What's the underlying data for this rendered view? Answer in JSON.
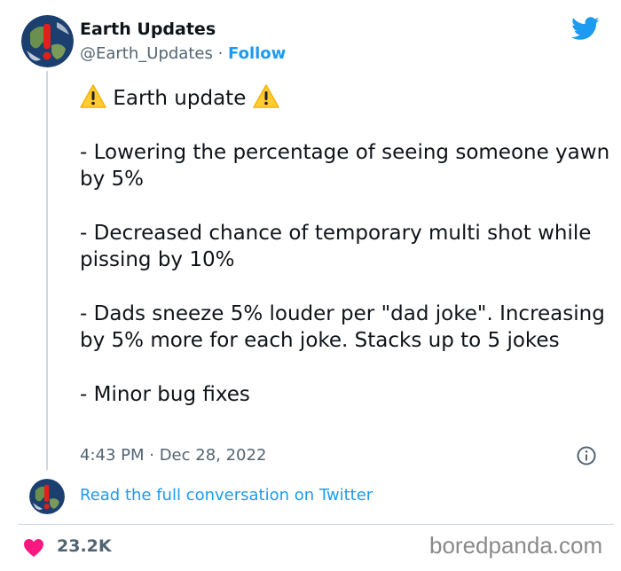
{
  "author": {
    "name": "Earth Updates",
    "handle": "@Earth_Updates",
    "separator": " · ",
    "follow_label": "Follow"
  },
  "tweet": {
    "title": "Earth update",
    "lines": [
      "- Lowering the percentage of seeing someone yawn by 5%",
      "- Decreased chance of temporary multi shot while pissing by 10%",
      "- Dads sneeze 5% louder per \"dad joke\". Increasing by 5% more for each joke. Stacks up to 5 jokes",
      "- Minor bug fixes"
    ],
    "timestamp": "4:43 PM · Dec 28, 2022"
  },
  "footer": {
    "read_full_label": "Read the full conversation on Twitter",
    "likes": "23.2K",
    "watermark": "boredpanda.com"
  },
  "colors": {
    "accent": "#1d9bf0",
    "heart": "#f91880",
    "muted": "#536471",
    "text": "#0f1419"
  },
  "icons": [
    "earth-avatar-icon",
    "twitter-bird-icon",
    "warning-icon",
    "info-icon",
    "heart-icon"
  ]
}
